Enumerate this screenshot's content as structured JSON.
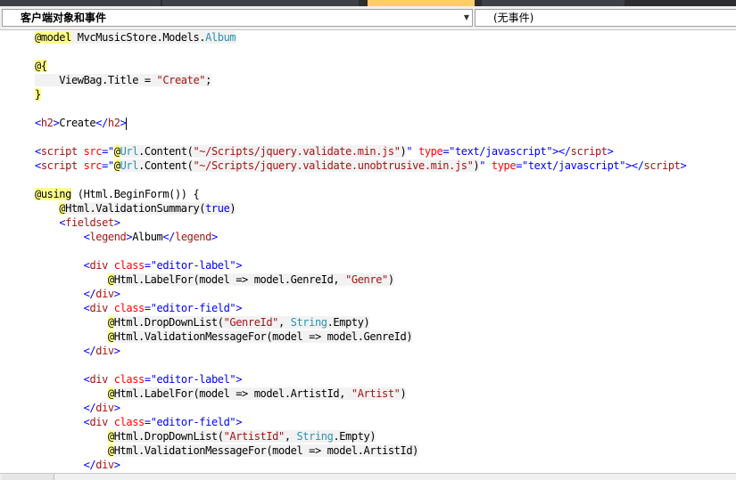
{
  "navigation": {
    "object_combo": "客户端对象和事件",
    "event_combo": "(无事件)"
  },
  "colors": {
    "tabstrip": "#2d2d30",
    "active_tab": "#ffcc66",
    "keyword": "#0000ff",
    "tag": "#a31515",
    "type": "#2b91af",
    "razor_highlight": "#ffff88"
  },
  "editor": {
    "lines": [
      {
        "segments": [
          {
            "t": "@model",
            "c": "tk-yellow"
          },
          {
            "t": " MvcMusicStore.Models.",
            "c": "tk-block"
          },
          {
            "t": "Album",
            "c": "tk-teal tk-block"
          }
        ]
      },
      {
        "segments": []
      },
      {
        "segments": [
          {
            "t": "@{",
            "c": "tk-yellow"
          }
        ]
      },
      {
        "segments": [
          {
            "t": "    ViewBag.Title = ",
            "c": "tk-block"
          },
          {
            "t": "\"Create\"",
            "c": "tk-str tk-block"
          },
          {
            "t": ";",
            "c": "tk-block"
          }
        ]
      },
      {
        "segments": [
          {
            "t": "}",
            "c": "tk-yellow"
          }
        ]
      },
      {
        "segments": []
      },
      {
        "segments": [
          {
            "t": "<",
            "c": "tk-blue"
          },
          {
            "t": "h2",
            "c": "tk-maroon"
          },
          {
            "t": ">",
            "c": "tk-blue"
          },
          {
            "t": "Create",
            "c": ""
          },
          {
            "t": "</",
            "c": "tk-blue"
          },
          {
            "t": "h2",
            "c": "tk-maroon"
          },
          {
            "t": ">",
            "c": "tk-blue"
          }
        ],
        "caret": true
      },
      {
        "segments": []
      },
      {
        "segments": [
          {
            "t": "<",
            "c": "tk-blue"
          },
          {
            "t": "script",
            "c": "tk-maroon"
          },
          {
            "t": " src",
            "c": "tk-red"
          },
          {
            "t": "=\"",
            "c": "tk-blue"
          },
          {
            "t": "@",
            "c": "tk-yellow"
          },
          {
            "t": "Url",
            "c": "tk-teal tk-block"
          },
          {
            "t": ".Content(",
            "c": "tk-block"
          },
          {
            "t": "\"~/Scripts/jquery.validate.min.js\"",
            "c": "tk-str tk-block"
          },
          {
            "t": ")",
            "c": "tk-block"
          },
          {
            "t": "\"",
            "c": "tk-blue"
          },
          {
            "t": " type",
            "c": "tk-red"
          },
          {
            "t": "=\"text/javascript\">",
            "c": "tk-blue"
          },
          {
            "t": "</",
            "c": "tk-blue"
          },
          {
            "t": "script",
            "c": "tk-maroon"
          },
          {
            "t": ">",
            "c": "tk-blue"
          }
        ]
      },
      {
        "segments": [
          {
            "t": "<",
            "c": "tk-blue"
          },
          {
            "t": "script",
            "c": "tk-maroon"
          },
          {
            "t": " src",
            "c": "tk-red"
          },
          {
            "t": "=\"",
            "c": "tk-blue"
          },
          {
            "t": "@",
            "c": "tk-yellow"
          },
          {
            "t": "Url",
            "c": "tk-teal tk-block"
          },
          {
            "t": ".Content(",
            "c": "tk-block"
          },
          {
            "t": "\"~/Scripts/jquery.validate.unobtrusive.min.js\"",
            "c": "tk-str tk-block"
          },
          {
            "t": ")",
            "c": "tk-block"
          },
          {
            "t": "\"",
            "c": "tk-blue"
          },
          {
            "t": " type",
            "c": "tk-red"
          },
          {
            "t": "=\"text/javascript\">",
            "c": "tk-blue"
          },
          {
            "t": "</",
            "c": "tk-blue"
          },
          {
            "t": "script",
            "c": "tk-maroon"
          },
          {
            "t": ">",
            "c": "tk-blue"
          }
        ]
      },
      {
        "segments": []
      },
      {
        "segments": [
          {
            "t": "@using",
            "c": "tk-yellow"
          },
          {
            "t": " (Html.BeginForm()) {",
            "c": ""
          }
        ]
      },
      {
        "segments": [
          {
            "t": "    ",
            "c": ""
          },
          {
            "t": "@",
            "c": "tk-yellow"
          },
          {
            "t": "Html.ValidationSummary(",
            "c": "tk-block"
          },
          {
            "t": "true",
            "c": "tk-blue tk-block"
          },
          {
            "t": ")",
            "c": "tk-block"
          }
        ]
      },
      {
        "segments": [
          {
            "t": "    ",
            "c": ""
          },
          {
            "t": "<",
            "c": "tk-blue"
          },
          {
            "t": "fieldset",
            "c": "tk-maroon"
          },
          {
            "t": ">",
            "c": "tk-blue"
          }
        ]
      },
      {
        "segments": [
          {
            "t": "        ",
            "c": ""
          },
          {
            "t": "<",
            "c": "tk-blue"
          },
          {
            "t": "legend",
            "c": "tk-maroon"
          },
          {
            "t": ">",
            "c": "tk-blue"
          },
          {
            "t": "Album",
            "c": ""
          },
          {
            "t": "</",
            "c": "tk-blue"
          },
          {
            "t": "legend",
            "c": "tk-maroon"
          },
          {
            "t": ">",
            "c": "tk-blue"
          }
        ]
      },
      {
        "segments": []
      },
      {
        "segments": [
          {
            "t": "        ",
            "c": ""
          },
          {
            "t": "<",
            "c": "tk-blue"
          },
          {
            "t": "div",
            "c": "tk-maroon"
          },
          {
            "t": " class",
            "c": "tk-red"
          },
          {
            "t": "=\"editor-label\">",
            "c": "tk-blue"
          }
        ]
      },
      {
        "segments": [
          {
            "t": "            ",
            "c": ""
          },
          {
            "t": "@",
            "c": "tk-yellow"
          },
          {
            "t": "Html.LabelFor(model => model.GenreId, ",
            "c": "tk-block"
          },
          {
            "t": "\"Genre\"",
            "c": "tk-str tk-block"
          },
          {
            "t": ")",
            "c": "tk-block"
          }
        ]
      },
      {
        "segments": [
          {
            "t": "        ",
            "c": ""
          },
          {
            "t": "</",
            "c": "tk-blue"
          },
          {
            "t": "div",
            "c": "tk-maroon"
          },
          {
            "t": ">",
            "c": "tk-blue"
          }
        ]
      },
      {
        "segments": [
          {
            "t": "        ",
            "c": ""
          },
          {
            "t": "<",
            "c": "tk-blue"
          },
          {
            "t": "div",
            "c": "tk-maroon"
          },
          {
            "t": " class",
            "c": "tk-red"
          },
          {
            "t": "=\"editor-field\">",
            "c": "tk-blue"
          }
        ]
      },
      {
        "segments": [
          {
            "t": "            ",
            "c": ""
          },
          {
            "t": "@",
            "c": "tk-yellow"
          },
          {
            "t": "Html.DropDownList(",
            "c": "tk-block"
          },
          {
            "t": "\"GenreId\"",
            "c": "tk-str tk-block"
          },
          {
            "t": ", ",
            "c": "tk-block"
          },
          {
            "t": "String",
            "c": "tk-teal tk-block"
          },
          {
            "t": ".Empty)",
            "c": "tk-block"
          }
        ]
      },
      {
        "segments": [
          {
            "t": "            ",
            "c": ""
          },
          {
            "t": "@",
            "c": "tk-yellow"
          },
          {
            "t": "Html.ValidationMessageFor(model => model.GenreId)",
            "c": "tk-block"
          }
        ]
      },
      {
        "segments": [
          {
            "t": "        ",
            "c": ""
          },
          {
            "t": "</",
            "c": "tk-blue"
          },
          {
            "t": "div",
            "c": "tk-maroon"
          },
          {
            "t": ">",
            "c": "tk-blue"
          }
        ]
      },
      {
        "segments": []
      },
      {
        "segments": [
          {
            "t": "        ",
            "c": ""
          },
          {
            "t": "<",
            "c": "tk-blue"
          },
          {
            "t": "div",
            "c": "tk-maroon"
          },
          {
            "t": " class",
            "c": "tk-red"
          },
          {
            "t": "=\"editor-label\">",
            "c": "tk-blue"
          }
        ]
      },
      {
        "segments": [
          {
            "t": "            ",
            "c": ""
          },
          {
            "t": "@",
            "c": "tk-yellow"
          },
          {
            "t": "Html.LabelFor(model => model.ArtistId, ",
            "c": "tk-block"
          },
          {
            "t": "\"Artist\"",
            "c": "tk-str tk-block"
          },
          {
            "t": ")",
            "c": "tk-block"
          }
        ]
      },
      {
        "segments": [
          {
            "t": "        ",
            "c": ""
          },
          {
            "t": "</",
            "c": "tk-blue"
          },
          {
            "t": "div",
            "c": "tk-maroon"
          },
          {
            "t": ">",
            "c": "tk-blue"
          }
        ]
      },
      {
        "segments": [
          {
            "t": "        ",
            "c": ""
          },
          {
            "t": "<",
            "c": "tk-blue"
          },
          {
            "t": "div",
            "c": "tk-maroon"
          },
          {
            "t": " class",
            "c": "tk-red"
          },
          {
            "t": "=\"editor-field\">",
            "c": "tk-blue"
          }
        ]
      },
      {
        "segments": [
          {
            "t": "            ",
            "c": ""
          },
          {
            "t": "@",
            "c": "tk-yellow"
          },
          {
            "t": "Html.DropDownList(",
            "c": "tk-block"
          },
          {
            "t": "\"ArtistId\"",
            "c": "tk-str tk-block"
          },
          {
            "t": ", ",
            "c": "tk-block"
          },
          {
            "t": "String",
            "c": "tk-teal tk-block"
          },
          {
            "t": ".Empty)",
            "c": "tk-block"
          }
        ]
      },
      {
        "segments": [
          {
            "t": "            ",
            "c": ""
          },
          {
            "t": "@",
            "c": "tk-yellow"
          },
          {
            "t": "Html.ValidationMessageFor(model => model.ArtistId)",
            "c": "tk-block"
          }
        ]
      },
      {
        "segments": [
          {
            "t": "        ",
            "c": ""
          },
          {
            "t": "</",
            "c": "tk-blue"
          },
          {
            "t": "div",
            "c": "tk-maroon"
          },
          {
            "t": ">",
            "c": "tk-blue"
          }
        ]
      }
    ]
  }
}
